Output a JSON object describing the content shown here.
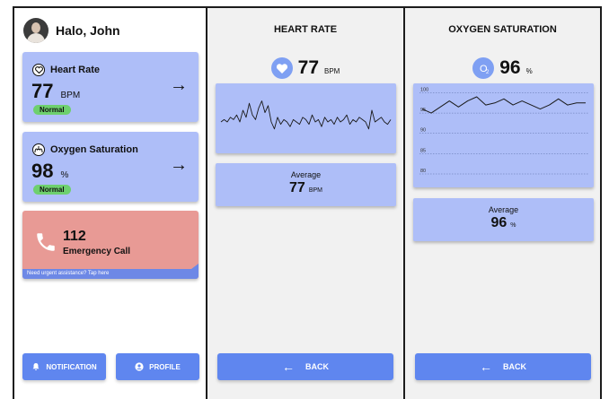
{
  "colors": {
    "card_blue": "#aebef8",
    "button_blue": "#5f86ef",
    "normal_green": "#6ed06e",
    "emergency_red": "#e89a95",
    "emergency_strip": "#6d88e6",
    "panel_grey": "#f1f1f1"
  },
  "home": {
    "greeting": "Halo, John",
    "avatar_icon": "user-avatar",
    "heart_card": {
      "icon": "heart-icon",
      "title": "Heart Rate",
      "value": "77",
      "unit": "BPM",
      "status": "Normal",
      "arrow_icon": "arrow-right-icon"
    },
    "oxygen_card": {
      "icon": "lungs-icon",
      "title": "Oxygen Saturation",
      "value": "98",
      "unit": "%",
      "status": "Normal",
      "arrow_icon": "arrow-right-icon"
    },
    "emergency": {
      "icon": "phone-icon",
      "number": "112",
      "label": "Emergency Call",
      "strip_text": "Need urgent assistance? Tap here"
    },
    "buttons": {
      "notification": "NOTIFICATION",
      "profile": "PROFILE"
    }
  },
  "heart_rate_screen": {
    "title": "HEART RATE",
    "icon": "heart-icon",
    "value": "77",
    "unit": "BPM",
    "average_label": "Average",
    "average_value": "77",
    "average_unit": "BPM",
    "back_label": "BACK"
  },
  "oxygen_screen": {
    "title": "OXYGEN SATURATION",
    "icon": "o2-icon",
    "icon_text": "O",
    "icon_sub": "2",
    "value": "96",
    "unit": "%",
    "axis_ticks": [
      "100",
      "95",
      "90",
      "85",
      "80"
    ],
    "average_label": "Average",
    "average_value": "96",
    "average_unit": "%",
    "back_label": "BACK"
  },
  "chart_data": [
    {
      "type": "line",
      "series": [
        {
          "values": [
            0,
            1,
            0,
            2,
            1,
            3,
            0,
            5,
            2,
            8,
            3,
            1,
            6,
            9,
            4,
            7,
            0,
            -3,
            2,
            -1,
            1,
            0,
            -2,
            1,
            0,
            -1,
            2,
            1,
            -1,
            3,
            0,
            1,
            -2,
            2,
            0,
            1,
            -1,
            2,
            0,
            1,
            3,
            -1,
            1,
            0,
            2,
            1,
            0,
            -3,
            5,
            0,
            1,
            2,
            0,
            -1,
            1
          ]
        }
      ]
    },
    {
      "type": "line",
      "y_ticks": [
        100,
        95,
        90,
        85,
        80
      ],
      "ylim": [
        78,
        101
      ],
      "series": [
        {
          "values": [
            96,
            95,
            96.5,
            98,
            96.5,
            98,
            99,
            97,
            97.5,
            98.5,
            97,
            98,
            97,
            96,
            97,
            98.5,
            97,
            97.5,
            97.5
          ]
        }
      ]
    }
  ]
}
